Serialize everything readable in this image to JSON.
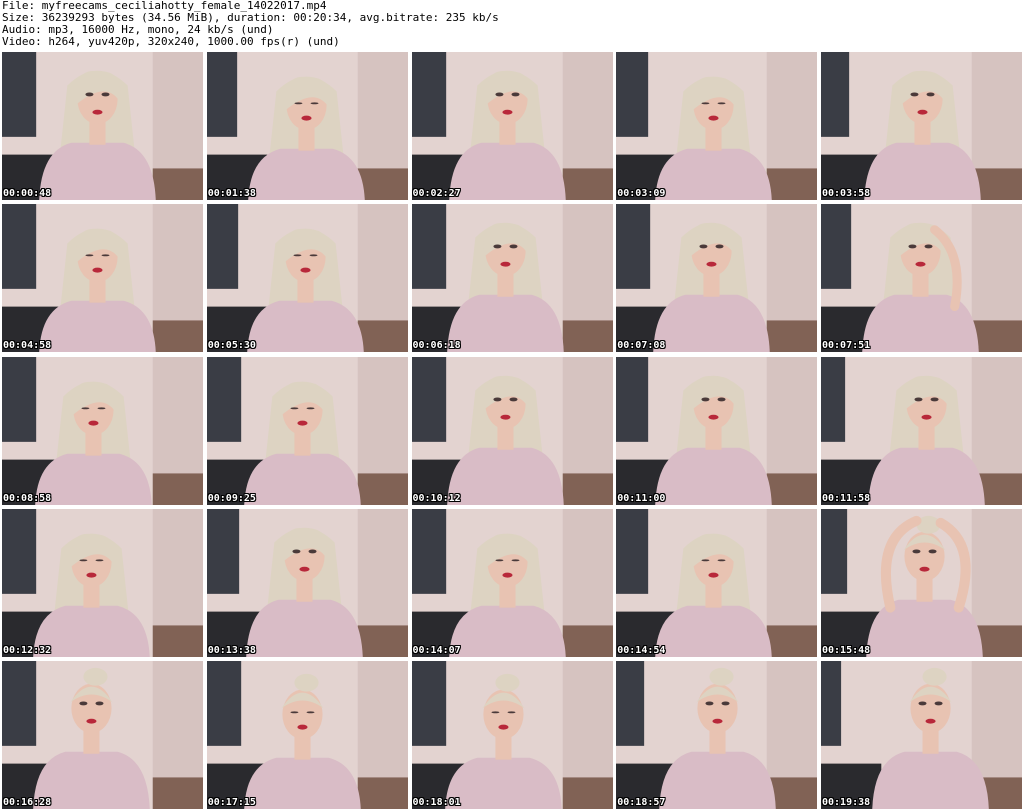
{
  "header": {
    "file": "File: myfreecams_ceciliahotty_female_14022017.mp4",
    "size": "Size: 36239293 bytes (34.56 MiB), duration: 00:20:34, avg.bitrate: 235 kb/s",
    "audio": "Audio: mp3, 16000 Hz, mono, 24 kb/s (und)",
    "video": "Video: h264, yuv420p, 320x240, 1000.00 fps(r) (und)"
  },
  "colors": {
    "wall": "#e3d3d0",
    "wall_shadow": "#cdb9b5",
    "poster": "#3a3d45",
    "hair": "#ddd3c2",
    "skin": "#e8c3b2",
    "shirt": "#d9bcc6",
    "shirt_print": "#efe3e8",
    "sofa": "#2a2a2e",
    "lips": "#b8283a"
  },
  "thumbnails": [
    {
      "time": "00:00:48",
      "pose": "straight",
      "hair": "down"
    },
    {
      "time": "00:01:38",
      "pose": "down",
      "hair": "down"
    },
    {
      "time": "00:02:27",
      "pose": "straight",
      "hair": "down"
    },
    {
      "time": "00:03:09",
      "pose": "down",
      "hair": "down"
    },
    {
      "time": "00:03:58",
      "pose": "side",
      "hair": "down"
    },
    {
      "time": "00:04:58",
      "pose": "down",
      "hair": "down"
    },
    {
      "time": "00:05:30",
      "pose": "down",
      "hair": "down"
    },
    {
      "time": "00:06:18",
      "pose": "straight",
      "hair": "down"
    },
    {
      "time": "00:07:08",
      "pose": "straight",
      "hair": "down"
    },
    {
      "time": "00:07:51",
      "pose": "tilt",
      "hair": "down"
    },
    {
      "time": "00:08:58",
      "pose": "down",
      "hair": "down"
    },
    {
      "time": "00:09:25",
      "pose": "down",
      "hair": "down"
    },
    {
      "time": "00:10:12",
      "pose": "straight",
      "hair": "down"
    },
    {
      "time": "00:11:00",
      "pose": "straight",
      "hair": "down"
    },
    {
      "time": "00:11:58",
      "pose": "straight",
      "hair": "down"
    },
    {
      "time": "00:12:32",
      "pose": "down",
      "hair": "down"
    },
    {
      "time": "00:13:38",
      "pose": "straight",
      "hair": "down"
    },
    {
      "time": "00:14:07",
      "pose": "down",
      "hair": "down"
    },
    {
      "time": "00:14:54",
      "pose": "down",
      "hair": "down"
    },
    {
      "time": "00:15:48",
      "pose": "arms-up",
      "hair": "up"
    },
    {
      "time": "00:16:28",
      "pose": "straight",
      "hair": "up"
    },
    {
      "time": "00:17:15",
      "pose": "down",
      "hair": "up"
    },
    {
      "time": "00:18:01",
      "pose": "down",
      "hair": "up"
    },
    {
      "time": "00:18:57",
      "pose": "straight",
      "hair": "up"
    },
    {
      "time": "00:19:38",
      "pose": "straight",
      "hair": "up"
    }
  ]
}
